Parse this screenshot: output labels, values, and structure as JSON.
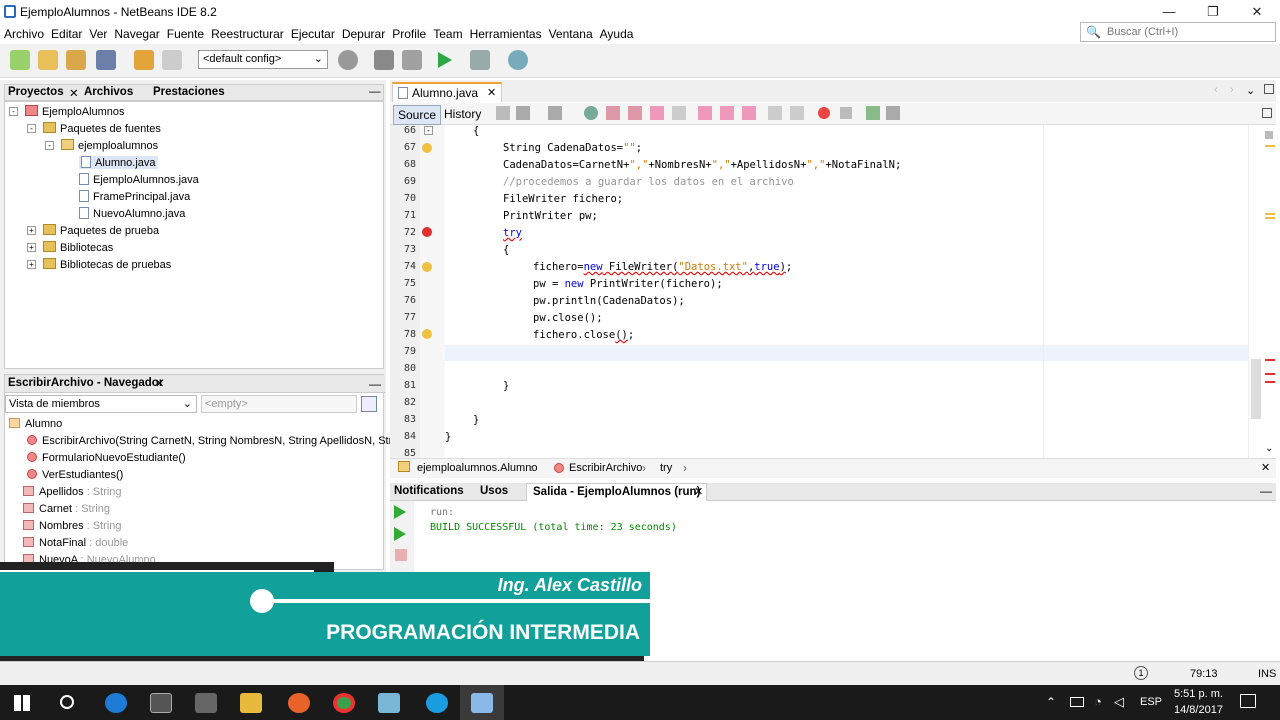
{
  "window": {
    "title": "EjemploAlumnos - NetBeans IDE 8.2",
    "minimize": "—",
    "maximize": "❐",
    "close": "✕"
  },
  "menu": [
    "Archivo",
    "Editar",
    "Ver",
    "Navegar",
    "Fuente",
    "Reestructurar",
    "Ejecutar",
    "Depurar",
    "Profile",
    "Team",
    "Herramientas",
    "Ventana",
    "Ayuda"
  ],
  "search": {
    "placeholder": "Buscar (Ctrl+I)"
  },
  "toolbar": {
    "config": "<default config>"
  },
  "projects": {
    "tabs": [
      "Proyectos",
      "Archivos",
      "Prestaciones"
    ],
    "tree": [
      "EjemploAlumnos",
      "Paquetes de fuentes",
      "ejemploalumnos",
      "Alumno.java",
      "EjemploAlumnos.java",
      "FramePrincipal.java",
      "NuevoAlumno.java",
      "Paquetes de prueba",
      "Bibliotecas",
      "Bibliotecas de pruebas"
    ]
  },
  "navigator": {
    "title": "EscribirArchivo - Navegador",
    "view": "Vista de miembros",
    "filter": "<empty>",
    "root": "Alumno",
    "members": [
      {
        "name": "EscribirArchivo(String CarnetN, String NombresN, String ApellidosN, String N",
        "type": ""
      },
      {
        "name": "FormularioNuevoEstudiante()",
        "type": ""
      },
      {
        "name": "VerEstudiantes()",
        "type": ""
      },
      {
        "name": "Apellidos",
        "type": " : String"
      },
      {
        "name": "Carnet",
        "type": " : String"
      },
      {
        "name": "Nombres",
        "type": " : String"
      },
      {
        "name": "NotaFinal",
        "type": " : double"
      },
      {
        "name": "NuevoA",
        "type": " : NuevoAlumno"
      }
    ]
  },
  "editor": {
    "tab": "Alumno.java",
    "source_label": "Source",
    "history_label": "History",
    "lines": [
      "66",
      "67",
      "68",
      "69",
      "70",
      "71",
      "72",
      "73",
      "74",
      "75",
      "76",
      "77",
      "78",
      "79",
      "80",
      "81",
      "82",
      "83",
      "84",
      "85"
    ]
  },
  "breadcrumb": [
    "ejemploalumnos.Alumno",
    "EscribirArchivo",
    "try"
  ],
  "output": {
    "tabs": [
      "Notifications",
      "Usos",
      "Salida - EjemploAlumnos (run)"
    ],
    "lines": [
      "run:",
      "BUILD SUCCESSFUL (total time: 23 seconds)"
    ]
  },
  "status": {
    "position": "79:13",
    "mode": "INS"
  },
  "banner": {
    "name": "Ing. Alex Castillo",
    "course": "PROGRAMACIÓN INTERMEDIA"
  },
  "taskbar": {
    "lang": "ESP",
    "time": "5:51 p. m.",
    "date": "14/8/2017"
  }
}
